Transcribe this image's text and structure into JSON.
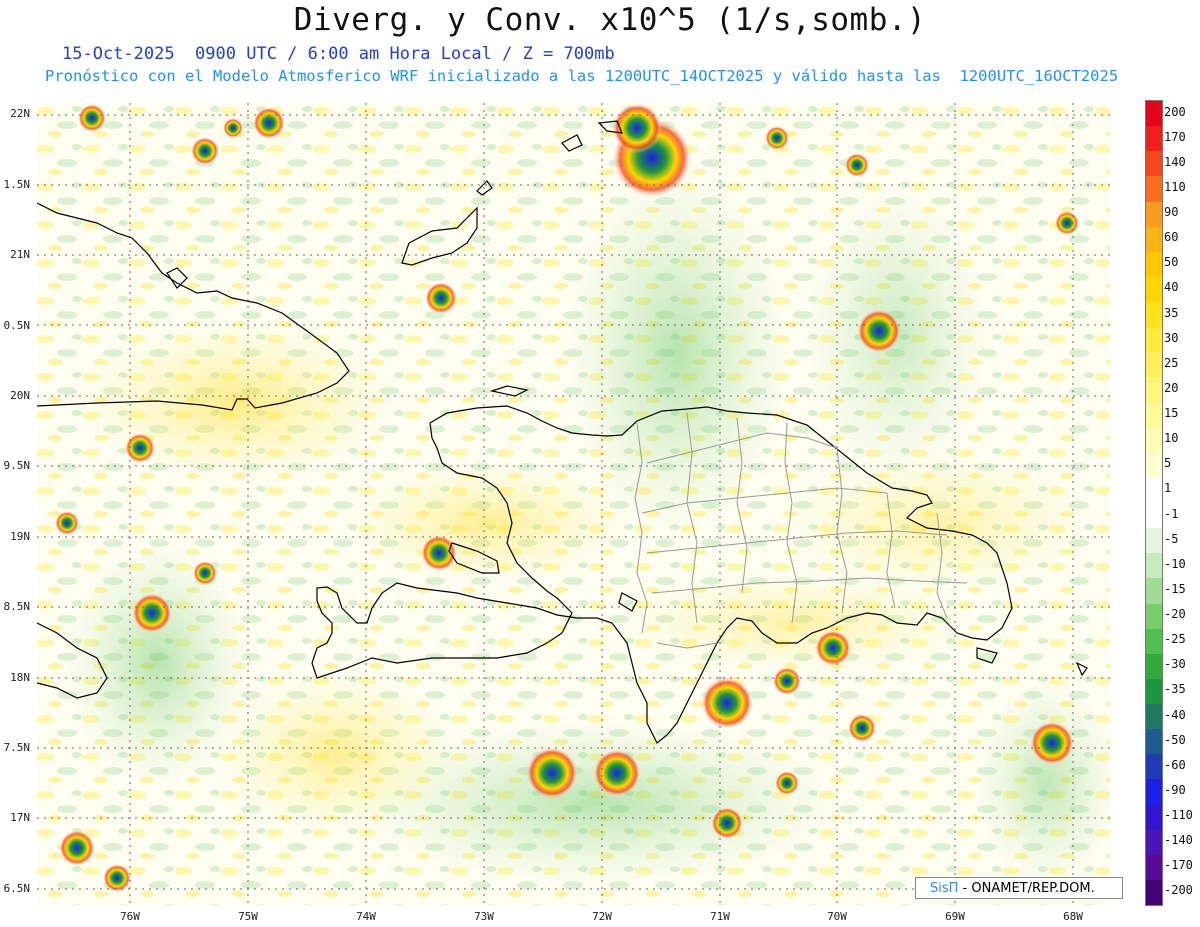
{
  "title": "Diverg. y Conv. x10^5 (1/s,somb.)",
  "subtitle_line1": "15-Oct-2025  0900 UTC / 6:00 am Hora Local / Z = 700mb",
  "subtitle_line2": "Pronóstico con el Modelo Atmosferico WRF inicializado a las 1200UTC_14OCT2025 y válido hasta las  1200UTC_16OCT2025",
  "lat_labels": [
    "22N",
    "1.5N",
    "21N",
    "0.5N",
    "20N",
    "9.5N",
    "19N",
    "8.5N",
    "18N",
    "7.5N",
    "17N",
    "6.5N"
  ],
  "lon_labels": [
    "76W",
    "75W",
    "74W",
    "73W",
    "72W",
    "71W",
    "70W",
    "69W",
    "68W"
  ],
  "colorbar": {
    "labels": [
      "200",
      "170",
      "140",
      "110",
      "90",
      "60",
      "50",
      "40",
      "35",
      "30",
      "25",
      "20",
      "15",
      "10",
      "5",
      "1",
      "-1",
      "-5",
      "-10",
      "-15",
      "-20",
      "-25",
      "-30",
      "-35",
      "-40",
      "-50",
      "-60",
      "-90",
      "-110",
      "-140",
      "-170",
      "-200"
    ],
    "colors": [
      "#e6001a",
      "#f01e1e",
      "#f5461e",
      "#f86e1e",
      "#fa9a1e",
      "#fcb414",
      "#ffc800",
      "#ffd700",
      "#ffe11e",
      "#ffeb3c",
      "#fff05a",
      "#fff578",
      "#fffa96",
      "#fffcb4",
      "#fffdd2",
      "#ffffff",
      "#ffffff",
      "#e6f5e1",
      "#c8ebbe",
      "#a0dc96",
      "#78cd6e",
      "#50be50",
      "#32aa3c",
      "#1e963c",
      "#1e7864",
      "#1e5a8c",
      "#1e3cb4",
      "#1e1ee6",
      "#3214d2",
      "#4b14b4",
      "#5a0a96",
      "#460078"
    ]
  },
  "credit": {
    "brand": "SisΠ",
    "text": " - ONAMET/REP.DOM."
  }
}
